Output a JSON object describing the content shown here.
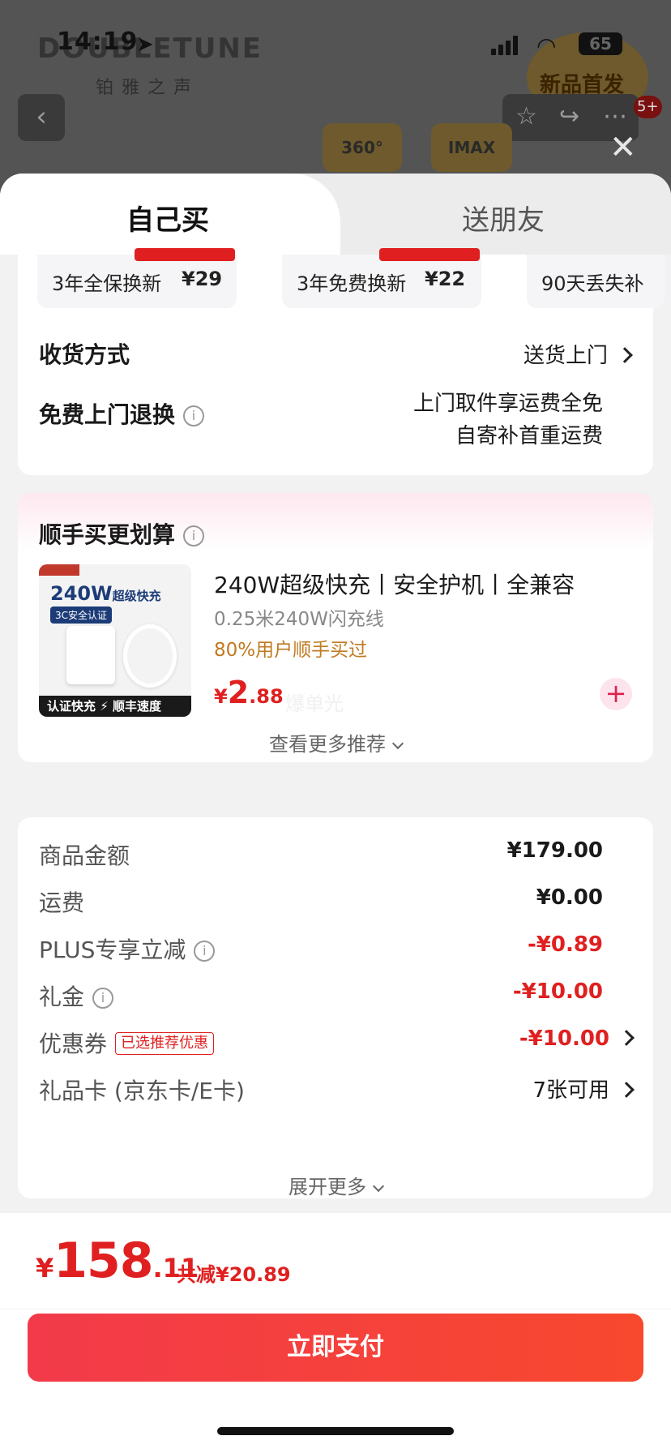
{
  "status_bar": {
    "time": "14:19",
    "battery": "65"
  },
  "background_page": {
    "brand": "DOUBLETUNE",
    "brand_sub": "铂雅之声",
    "new_badge": "新品首发",
    "message_count": "5+",
    "feature_1": "360°",
    "feature_2": "IMAX"
  },
  "tabs": {
    "self": "自己买",
    "gift": "送朋友"
  },
  "warranty": [
    {
      "name": "3年全保换新",
      "price": "¥29"
    },
    {
      "name": "3年免费换新",
      "price": "¥22"
    },
    {
      "name": "90天丢失补"
    }
  ],
  "delivery": {
    "label": "收货方式",
    "value": "送货上门"
  },
  "returns": {
    "label": "免费上门退换",
    "note_line1": "上门取件享运费全免",
    "note_line2": "自寄补首重运费"
  },
  "addon": {
    "title": "顺手买更划算",
    "product": {
      "image_text_big": "240W",
      "image_text_big_suffix": "超级快充",
      "image_text_cert": "3C安全认证",
      "image_bar": "认证快充  ⚡ 顺丰速度",
      "title": "240W超级快充丨安全护机丨全兼容",
      "subtitle": "0.25米240W闪充线",
      "popularity": "80%用户顺手买过",
      "price_currency": "¥",
      "price_int": "2",
      "price_dec": ".88",
      "price_note": "爆单光"
    },
    "see_more": "查看更多推荐"
  },
  "summary": {
    "rows": [
      {
        "label": "商品金额",
        "value": "¥179.00"
      },
      {
        "label": "运费",
        "value": "¥0.00"
      },
      {
        "label": "PLUS专享立减",
        "value": "-¥0.89"
      },
      {
        "label": "礼金",
        "value": "-¥10.00"
      },
      {
        "label": "优惠券",
        "tag": "已选推荐优惠",
        "value": "-¥10.00"
      },
      {
        "label": "礼品卡 (京东卡/E卡)",
        "value": "7张可用"
      }
    ],
    "expand": "展开更多"
  },
  "footer": {
    "total_currency": "¥",
    "total_int": "158",
    "total_dec": ".11",
    "saved": "共减¥20.89",
    "pay_label": "立即支付"
  },
  "colors": {
    "accent_red": "#e02020",
    "pay_gradient_start": "#f23a4a",
    "pay_gradient_end": "#f8482e",
    "popularity_orange": "#c07a20"
  },
  "icons": [
    "back-icon",
    "star-icon",
    "share-icon",
    "more-icon",
    "close-icon",
    "info-icon",
    "chevron-right-icon",
    "chevron-down-icon",
    "plus-icon"
  ]
}
